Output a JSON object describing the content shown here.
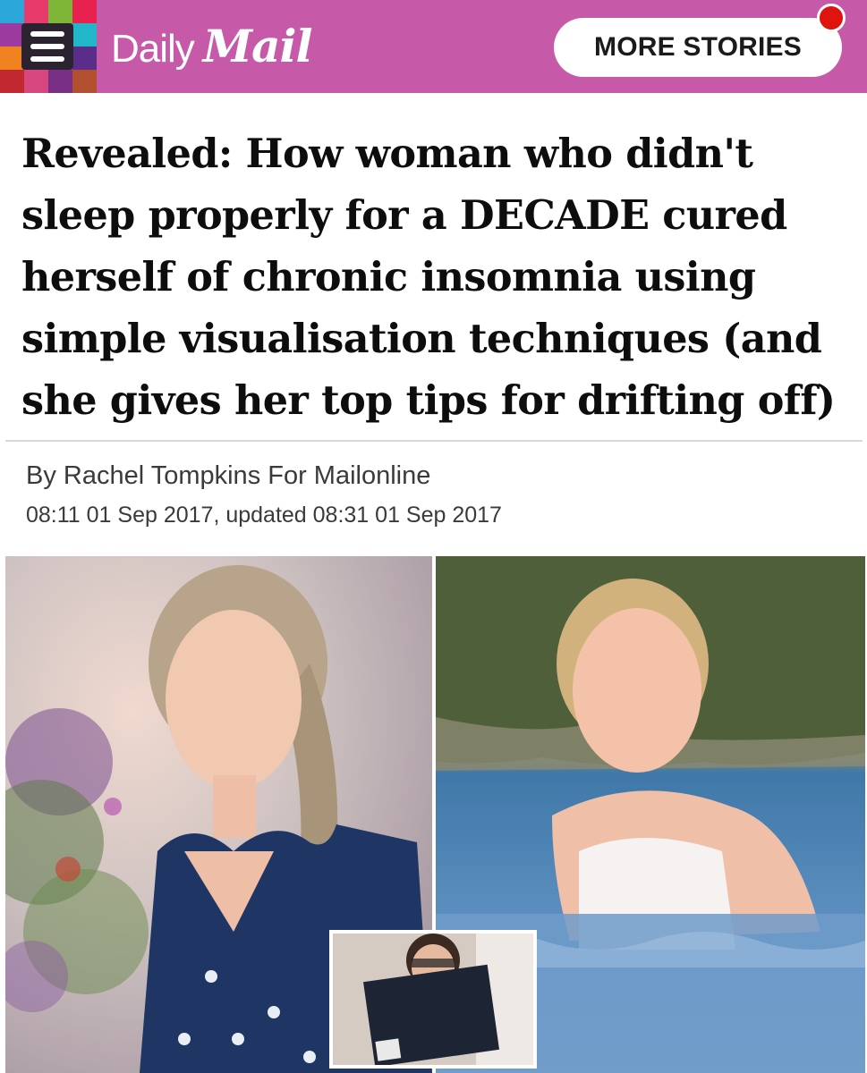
{
  "header": {
    "logo_daily": "Daily",
    "logo_mail": "Mail",
    "more_stories_label": "MORE STORIES",
    "menu_icon": "hamburger-menu-icon",
    "notification_icon": "notification-dot-icon",
    "brand_color": "#c65aa9",
    "notification_color": "#e0140f"
  },
  "article": {
    "headline": "Revealed: How woman who didn't sleep properly for a DECADE cured herself of chronic insomnia using simple visualisation techniques (and she gives her top tips for drifting off)",
    "byline": "By Rachel Tompkins For Mailonline",
    "timestamp": "08:11 01 Sep 2017, updated 08:31 01 Sep 2017"
  },
  "images": {
    "left": "photo-woman-portrait",
    "right": "photo-woman-swimming-in-sea",
    "inset": "photo-woman-holding-go-to-sleep-book"
  }
}
